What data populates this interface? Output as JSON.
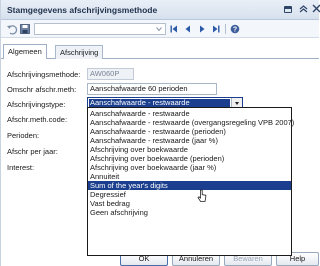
{
  "window": {
    "title": "Stamgegevens afschrijvingsmethode"
  },
  "titlebar_icons": [
    "restore-icon",
    "collapse-up-icon",
    "close-icon"
  ],
  "toolbar": {
    "combo_value": "",
    "icons": [
      "undo-icon",
      "save-icon",
      "first-record-icon",
      "previous-record-icon",
      "next-record-icon",
      "last-record-icon",
      "help-icon"
    ]
  },
  "tabs": [
    {
      "label": "Algemeen",
      "active": true
    },
    {
      "label": "Afschrijving",
      "active": false
    }
  ],
  "form": {
    "methode": {
      "label": "Afschrijvingsmethode:",
      "value": "AW060P"
    },
    "omschrijving": {
      "label": "Omschr afschr.meth:",
      "value": "Aanschafwaarde 60 perioden"
    },
    "type": {
      "label": "Afschrijvingstype:",
      "value": "Aanschafwaarde - restwaarde"
    },
    "code": {
      "label": "Afschr.meth.code:"
    },
    "perioden": {
      "label": "Perioden:"
    },
    "per_jaar": {
      "label": "Afschr per jaar:"
    },
    "interest": {
      "label": "Interest:"
    }
  },
  "dropdown": {
    "options": [
      "Aanschafwaarde - restwaarde",
      "Aanschafwaarde - restwaarde (overgangsregeling VPB 2007)",
      "Aanschafwaarde - restwaarde (perioden)",
      "Aanschafwaarde - restwaarde (jaar %)",
      "Afschrijving over boekwaarde",
      "Afschrijving over boekwaarde (perioden)",
      "Afschrijving over boekwaarde (jaar %)",
      "Annuiteit",
      "Sum of the year's digits",
      "Degressief",
      "Vast bedrag",
      "Geen afschrijving"
    ],
    "highlighted_index": 8
  },
  "buttons": {
    "ok": "OK",
    "cancel": "Annuleren",
    "save": "Bewaren",
    "help": "Help"
  },
  "colors": {
    "selection": "#1b3f8e",
    "title_text": "#23344f"
  }
}
